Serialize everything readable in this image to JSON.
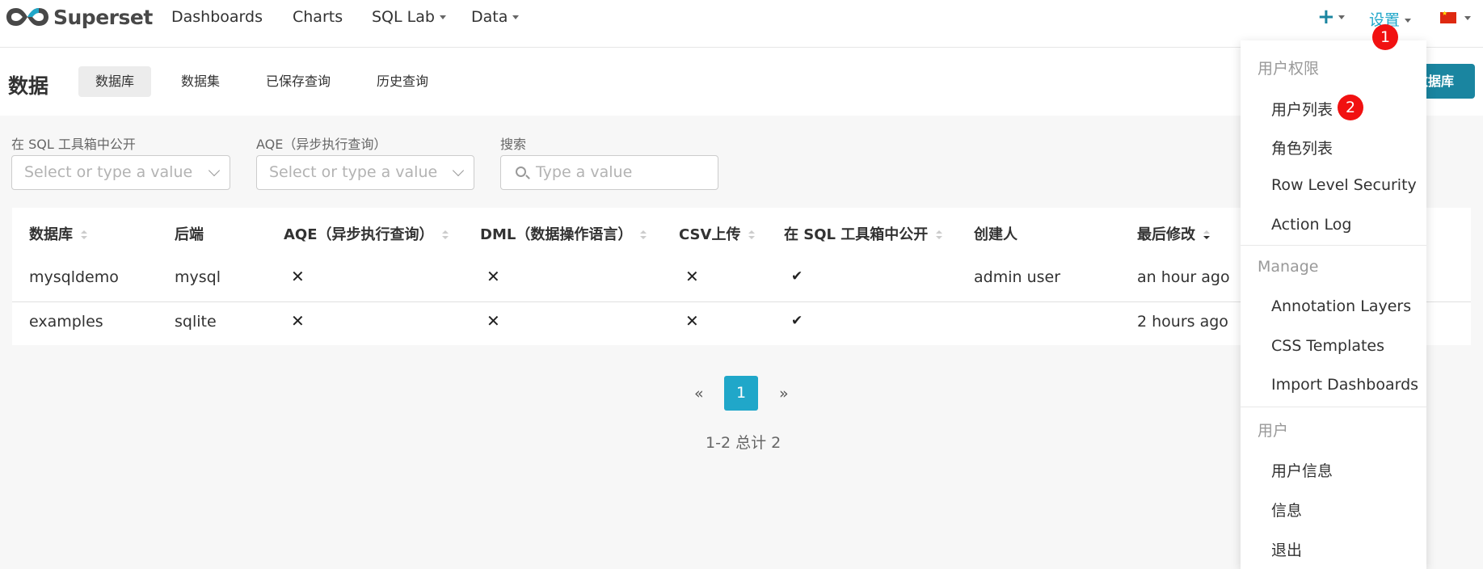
{
  "nav": {
    "brand": "Superset",
    "links": [
      "Dashboards",
      "Charts",
      "SQL Lab",
      "Data"
    ],
    "plus": "+",
    "settings": "设置"
  },
  "badges": [
    "1",
    "2"
  ],
  "subheader": {
    "title": "数据",
    "tabs": [
      "数据库",
      "数据集",
      "已保存查询",
      "历史查询"
    ],
    "add_button": "数据库"
  },
  "filters": {
    "sqllab_label": "在 SQL 工具箱中公开",
    "sqllab_placeholder": "Select or type a value",
    "aqe_label": "AQE（异步执行查询）",
    "aqe_placeholder": "Select or type a value",
    "search_label": "搜索",
    "search_placeholder": "Type a value"
  },
  "table": {
    "columns": [
      "数据库",
      "后端",
      "AQE（异步执行查询）",
      "DML（数据操作语言）",
      "CSV上传",
      "在 SQL 工具箱中公开",
      "创建人",
      "最后修改"
    ],
    "rows": [
      {
        "database": "mysqldemo",
        "backend": "mysql",
        "aqe": "✕",
        "dml": "✕",
        "csv": "✕",
        "sqllab": "✔",
        "creator": "admin user",
        "modified": "an hour ago"
      },
      {
        "database": "examples",
        "backend": "sqlite",
        "aqe": "✕",
        "dml": "✕",
        "csv": "✕",
        "sqllab": "✔",
        "creator": "",
        "modified": "2 hours ago"
      }
    ]
  },
  "pagination": {
    "prev": "«",
    "current": "1",
    "next": "»",
    "summary": "1-2 总计 2"
  },
  "menu": {
    "groups": [
      {
        "label": "用户权限",
        "items": [
          "用户列表",
          "角色列表",
          "Row Level Security",
          "Action Log"
        ]
      },
      {
        "label": "Manage",
        "items": [
          "Annotation Layers",
          "CSS Templates",
          "Import Dashboards"
        ]
      },
      {
        "label": "用户",
        "items": [
          "用户信息",
          "信息",
          "退出"
        ]
      }
    ]
  },
  "colors": {
    "accent": "#20a7c9",
    "primary_button": "#1a85a0",
    "badge": "#f11111"
  }
}
